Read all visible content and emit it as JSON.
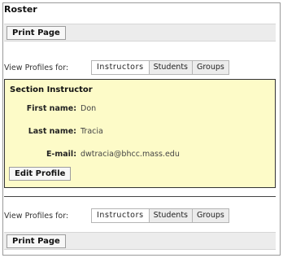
{
  "page": {
    "title": "Roster"
  },
  "toolbar": {
    "print_label": "Print Page"
  },
  "view_profiles": {
    "label": "View Profiles for:",
    "tabs": [
      {
        "label": "Instructors"
      },
      {
        "label": "Students"
      },
      {
        "label": "Groups"
      }
    ]
  },
  "profile": {
    "heading": "Section Instructor",
    "fields": [
      {
        "key": "First name:",
        "value": "Don"
      },
      {
        "key": "Last name:",
        "value": "Tracia"
      },
      {
        "key": "E-mail:",
        "value": "dwtracia@bhcc.mass.edu"
      }
    ],
    "edit_label": "Edit Profile"
  },
  "colors": {
    "panel_bg": "#fdfbc8",
    "bar_bg": "#ececec"
  }
}
